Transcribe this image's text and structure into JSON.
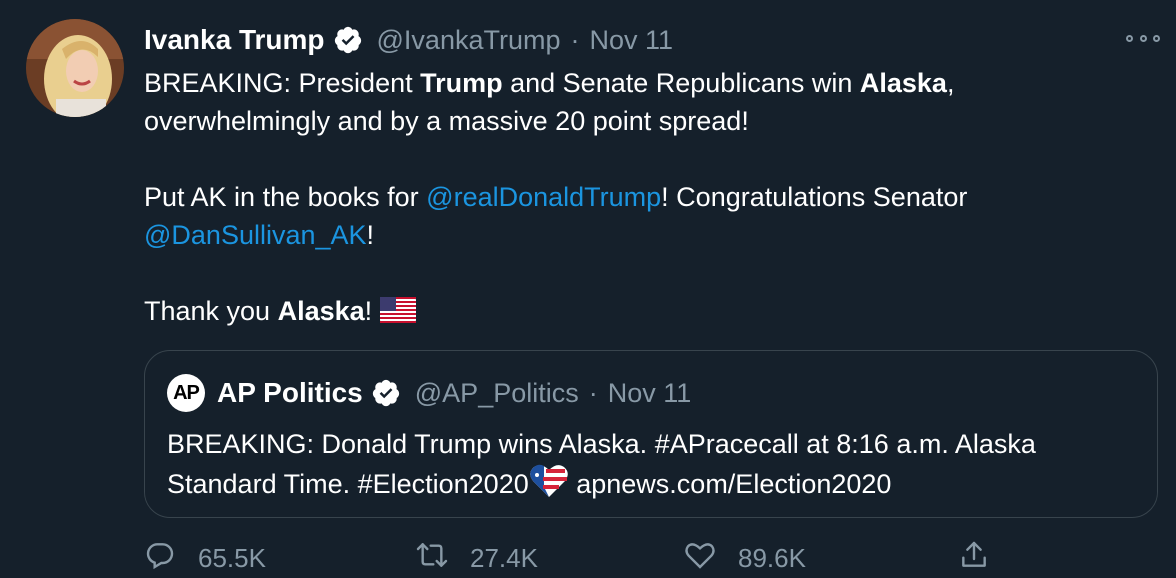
{
  "tweet": {
    "author_name": "Ivanka Trump",
    "author_handle": "@IvankaTrump",
    "separator": "·",
    "date": "Nov 11",
    "line1_pre": "BREAKING: President ",
    "line1_bold1": "Trump",
    "line1_mid": " and Senate Republicans win ",
    "line1_bold2": "Alaska",
    "line1_post": ",",
    "line2": "overwhelmingly and by a massive 20 point spread!",
    "para2_pre": "Put AK in the books for ",
    "para2_mention1": "@realDonaldTrump",
    "para2_mid": "! Congratulations Senator",
    "para2_mention2": "@DanSullivan_AK",
    "para2_post": "!",
    "para3_pre": "Thank you ",
    "para3_bold": "Alaska",
    "para3_post": "! "
  },
  "quote": {
    "logo_text": "AP",
    "author_name": "AP Politics",
    "author_handle": "@AP_Politics",
    "separator": "·",
    "date": "Nov 11",
    "line1": "BREAKING: Donald Trump wins Alaska. #APracecall at 8:16 a.m. Alaska",
    "line2_pre": "Standard Time. #Election2020",
    "line2_post": " apnews.com/Election2020"
  },
  "actions": {
    "reply_count": "65.5K",
    "retweet_count": "27.4K",
    "like_count": "89.6K"
  },
  "icons": {
    "verified": "verified-badge-icon",
    "more": "more-options-icon",
    "reply": "reply-icon",
    "retweet": "retweet-icon",
    "like": "heart-icon",
    "share": "share-icon",
    "flag": "us-flag-icon",
    "election": "election-heart-icon"
  },
  "colors": {
    "background": "#15202b",
    "link": "#1b95e0",
    "secondary": "#8899a6",
    "border": "#38444d"
  }
}
